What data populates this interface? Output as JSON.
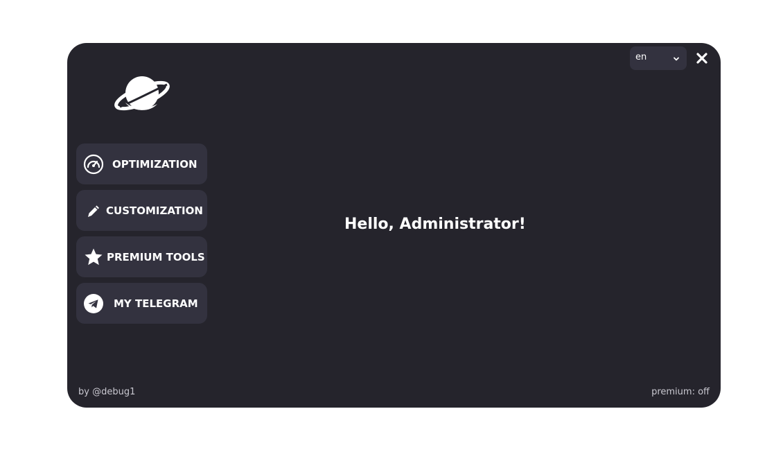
{
  "language": {
    "selected": "en"
  },
  "nav": {
    "items": [
      {
        "label": "OPTIMIZATION",
        "icon": "speedometer-icon"
      },
      {
        "label": "CUSTOMIZATION",
        "icon": "pencil-icon"
      },
      {
        "label": "PREMIUM TOOLS",
        "icon": "star-icon"
      },
      {
        "label": "MY TELEGRAM",
        "icon": "telegram-icon"
      }
    ]
  },
  "main": {
    "greeting": "Hello, Administrator!"
  },
  "footer": {
    "author": "by @debug1",
    "premium_status": "premium: off"
  },
  "colors": {
    "window_bg": "#25242c",
    "button_bg": "#33323f",
    "text": "#ffffff"
  }
}
